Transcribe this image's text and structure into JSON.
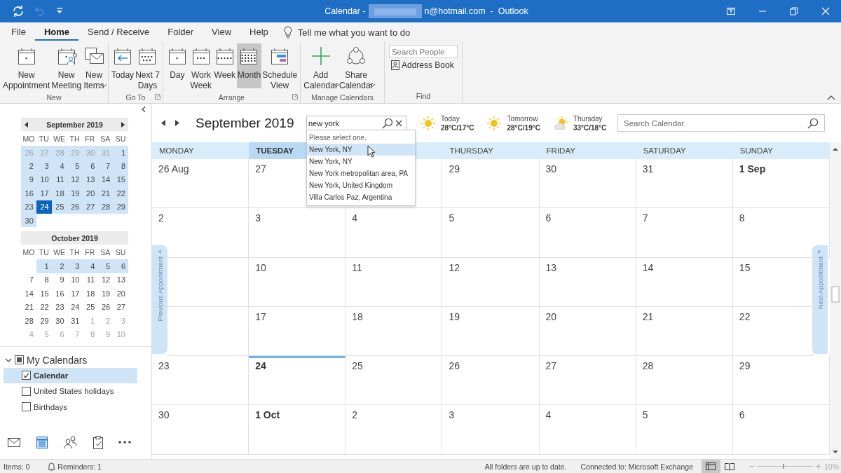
{
  "title_bar": {
    "title_start": "Calendar -",
    "title_end": "n@hotmail.com  -  Outlook"
  },
  "ribbon": {
    "tabs": [
      {
        "label": "File",
        "selected": false
      },
      {
        "label": "Home",
        "selected": true
      },
      {
        "label": "Send / Receive",
        "selected": false
      },
      {
        "label": "Folder",
        "selected": false
      },
      {
        "label": "View",
        "selected": false
      },
      {
        "label": "Help",
        "selected": false
      }
    ],
    "tell_me": "Tell me what you want to do",
    "groups": [
      {
        "kind": "buttons",
        "label": "New",
        "launcher": false,
        "buttons": [
          {
            "kind": "appointment",
            "label": "New\nAppointment",
            "dropdown": false,
            "selected": false
          },
          {
            "kind": "meeting",
            "label": "New\nMeeting",
            "dropdown": false,
            "selected": false
          },
          {
            "kind": "items",
            "label": "New\nItems",
            "dropdown": true,
            "selected": false
          }
        ]
      },
      {
        "kind": "buttons",
        "label": "Go To",
        "launcher": true,
        "buttons": [
          {
            "kind": "today",
            "label": "Today",
            "dropdown": false,
            "selected": false
          },
          {
            "kind": "next7",
            "label": "Next 7\nDays",
            "dropdown": false,
            "selected": false
          }
        ]
      },
      {
        "kind": "buttons",
        "label": "Arrange",
        "launcher": true,
        "buttons": [
          {
            "kind": "day",
            "label": "Day",
            "dropdown": false,
            "selected": false
          },
          {
            "kind": "workweek",
            "label": "Work\nWeek",
            "dropdown": false,
            "selected": false
          },
          {
            "kind": "week",
            "label": "Week",
            "dropdown": false,
            "selected": false
          },
          {
            "kind": "month",
            "label": "Month",
            "dropdown": false,
            "selected": true
          },
          {
            "kind": "schedule",
            "label": "Schedule\nView",
            "dropdown": false,
            "selected": false
          }
        ]
      },
      {
        "kind": "buttons",
        "label": "Manage Calendars",
        "launcher": false,
        "buttons": [
          {
            "kind": "add",
            "label": "Add\nCalendar",
            "dropdown": true,
            "selected": false
          },
          {
            "kind": "share",
            "label": "Share\nCalendar",
            "dropdown": true,
            "selected": false
          }
        ]
      },
      {
        "kind": "find",
        "label": "Find",
        "launcher": false,
        "search_placeholder": "Search People",
        "address_book": "Address Book"
      }
    ]
  },
  "sidebar": {
    "mini_calendars": [
      {
        "title": "September 2019",
        "weekdays": [
          "MO",
          "TU",
          "WE",
          "TH",
          "FR",
          "SA",
          "SU"
        ],
        "weeks": [
          [
            {
              "day": "26",
              "in_view": true,
              "selected": false,
              "outside": true
            },
            {
              "day": "27",
              "in_view": true,
              "selected": false,
              "outside": true
            },
            {
              "day": "28",
              "in_view": true,
              "selected": false,
              "outside": true
            },
            {
              "day": "29",
              "in_view": true,
              "selected": false,
              "outside": true
            },
            {
              "day": "30",
              "in_view": true,
              "selected": false,
              "outside": true
            },
            {
              "day": "31",
              "in_view": true,
              "selected": false,
              "outside": true
            },
            {
              "day": "1",
              "in_view": true,
              "selected": false,
              "outside": false
            }
          ],
          [
            {
              "day": "2",
              "in_view": true,
              "selected": false,
              "outside": false
            },
            {
              "day": "3",
              "in_view": true,
              "selected": false,
              "outside": false
            },
            {
              "day": "4",
              "in_view": true,
              "selected": false,
              "outside": false
            },
            {
              "day": "5",
              "in_view": true,
              "selected": false,
              "outside": false
            },
            {
              "day": "6",
              "in_view": true,
              "selected": false,
              "outside": false
            },
            {
              "day": "7",
              "in_view": true,
              "selected": false,
              "outside": false
            },
            {
              "day": "8",
              "in_view": true,
              "selected": false,
              "outside": false
            }
          ],
          [
            {
              "day": "9",
              "in_view": true,
              "selected": false,
              "outside": false
            },
            {
              "day": "10",
              "in_view": true,
              "selected": false,
              "outside": false
            },
            {
              "day": "11",
              "in_view": true,
              "selected": false,
              "outside": false
            },
            {
              "day": "12",
              "in_view": true,
              "selected": false,
              "outside": false
            },
            {
              "day": "13",
              "in_view": true,
              "selected": false,
              "outside": false
            },
            {
              "day": "14",
              "in_view": true,
              "selected": false,
              "outside": false
            },
            {
              "day": "15",
              "in_view": true,
              "selected": false,
              "outside": false
            }
          ],
          [
            {
              "day": "16",
              "in_view": true,
              "selected": false,
              "outside": false
            },
            {
              "day": "17",
              "in_view": true,
              "selected": false,
              "outside": false
            },
            {
              "day": "18",
              "in_view": true,
              "selected": false,
              "outside": false
            },
            {
              "day": "19",
              "in_view": true,
              "selected": false,
              "outside": false
            },
            {
              "day": "20",
              "in_view": true,
              "selected": false,
              "outside": false
            },
            {
              "day": "21",
              "in_view": true,
              "selected": false,
              "outside": false
            },
            {
              "day": "22",
              "in_view": true,
              "selected": false,
              "outside": false
            }
          ],
          [
            {
              "day": "23",
              "in_view": true,
              "selected": false,
              "outside": false
            },
            {
              "day": "24",
              "in_view": true,
              "selected": true,
              "outside": false
            },
            {
              "day": "25",
              "in_view": true,
              "selected": false,
              "outside": false
            },
            {
              "day": "26",
              "in_view": true,
              "selected": false,
              "outside": false
            },
            {
              "day": "27",
              "in_view": true,
              "selected": false,
              "outside": false
            },
            {
              "day": "28",
              "in_view": true,
              "selected": false,
              "outside": false
            },
            {
              "day": "29",
              "in_view": true,
              "selected": false,
              "outside": false
            }
          ],
          [
            {
              "day": "30",
              "in_view": true,
              "selected": false,
              "outside": false
            }
          ]
        ]
      },
      {
        "title": "October 2019",
        "weekdays": [
          "MO",
          "TU",
          "WE",
          "TH",
          "FR",
          "SA",
          "SU"
        ],
        "weeks": [
          [
            {
              "day": "1",
              "in_view": true,
              "selected": false,
              "outside": false
            },
            {
              "day": "2",
              "in_view": true,
              "selected": false,
              "outside": false
            },
            {
              "day": "3",
              "in_view": true,
              "selected": false,
              "outside": false
            },
            {
              "day": "4",
              "in_view": true,
              "selected": false,
              "outside": false
            },
            {
              "day": "5",
              "in_view": true,
              "selected": false,
              "outside": false
            },
            {
              "day": "6",
              "in_view": true,
              "selected": false,
              "outside": false
            }
          ],
          [
            {
              "day": "7",
              "in_view": false,
              "selected": false,
              "outside": false
            },
            {
              "day": "8",
              "in_view": false,
              "selected": false,
              "outside": false
            },
            {
              "day": "9",
              "in_view": false,
              "selected": false,
              "outside": false
            },
            {
              "day": "10",
              "in_view": false,
              "selected": false,
              "outside": false
            },
            {
              "day": "11",
              "in_view": false,
              "selected": false,
              "outside": false
            },
            {
              "day": "12",
              "in_view": false,
              "selected": false,
              "outside": false
            },
            {
              "day": "13",
              "in_view": false,
              "selected": false,
              "outside": false
            }
          ],
          [
            {
              "day": "14",
              "in_view": false,
              "selected": false,
              "outside": false
            },
            {
              "day": "15",
              "in_view": false,
              "selected": false,
              "outside": false
            },
            {
              "day": "16",
              "in_view": false,
              "selected": false,
              "outside": false
            },
            {
              "day": "17",
              "in_view": false,
              "selected": false,
              "outside": false
            },
            {
              "day": "18",
              "in_view": false,
              "selected": false,
              "outside": false
            },
            {
              "day": "19",
              "in_view": false,
              "selected": false,
              "outside": false
            },
            {
              "day": "20",
              "in_view": false,
              "selected": false,
              "outside": false
            }
          ],
          [
            {
              "day": "21",
              "in_view": false,
              "selected": false,
              "outside": false
            },
            {
              "day": "22",
              "in_view": false,
              "selected": false,
              "outside": false
            },
            {
              "day": "23",
              "in_view": false,
              "selected": false,
              "outside": false
            },
            {
              "day": "24",
              "in_view": false,
              "selected": false,
              "outside": false
            },
            {
              "day": "25",
              "in_view": false,
              "selected": false,
              "outside": false
            },
            {
              "day": "26",
              "in_view": false,
              "selected": false,
              "outside": false
            },
            {
              "day": "27",
              "in_view": false,
              "selected": false,
              "outside": false
            }
          ],
          [
            {
              "day": "28",
              "in_view": false,
              "selected": false,
              "outside": false
            },
            {
              "day": "29",
              "in_view": false,
              "selected": false,
              "outside": false
            },
            {
              "day": "30",
              "in_view": false,
              "selected": false,
              "outside": false
            },
            {
              "day": "31",
              "in_view": false,
              "selected": false,
              "outside": false
            },
            {
              "day": "1",
              "in_view": false,
              "selected": false,
              "outside": true
            },
            {
              "day": "2",
              "in_view": false,
              "selected": false,
              "outside": true
            },
            {
              "day": "3",
              "in_view": false,
              "selected": false,
              "outside": true
            }
          ],
          [
            {
              "day": "4",
              "in_view": false,
              "selected": false,
              "outside": true
            },
            {
              "day": "5",
              "in_view": false,
              "selected": false,
              "outside": true
            },
            {
              "day": "6",
              "in_view": false,
              "selected": false,
              "outside": true
            },
            {
              "day": "7",
              "in_view": false,
              "selected": false,
              "outside": true
            },
            {
              "day": "8",
              "in_view": false,
              "selected": false,
              "outside": true
            },
            {
              "day": "9",
              "in_view": false,
              "selected": false,
              "outside": true
            },
            {
              "day": "10",
              "in_view": false,
              "selected": false,
              "outside": true
            }
          ]
        ]
      }
    ],
    "calendar_groups": [
      {
        "label": "My Calendars",
        "expanded": true,
        "indeterminate": true,
        "items": [
          {
            "label": "Calendar",
            "checked": true,
            "selected": true
          },
          {
            "label": "United States holidays",
            "checked": false,
            "selected": false
          },
          {
            "label": "Birthdays",
            "checked": false,
            "selected": false
          }
        ]
      }
    ],
    "nav_bar": [
      {
        "kind": "mail",
        "selected": false
      },
      {
        "kind": "calendar",
        "selected": true
      },
      {
        "kind": "people",
        "selected": false
      },
      {
        "kind": "tasks",
        "selected": false
      },
      {
        "kind": "more",
        "selected": false
      }
    ]
  },
  "calendar": {
    "month_title": "September 2019",
    "location_search": {
      "value": "new york"
    },
    "location_dropdown": {
      "prompt": "Please select one.",
      "options": [
        {
          "label": "New York, NY",
          "selected": true
        },
        {
          "label": "New York, NY",
          "selected": false
        },
        {
          "label": "New York metropolitan area, PA",
          "selected": false
        },
        {
          "label": "New York, United Kingdom",
          "selected": false
        },
        {
          "label": "Villa Carlos Paz, Argentina",
          "selected": false
        }
      ]
    },
    "weather": [
      {
        "kind": "sunny",
        "day": "Today",
        "temps": "28°C/17°C"
      },
      {
        "kind": "sunny",
        "day": "Tomorrow",
        "temps": "28°C/19°C"
      },
      {
        "kind": "partly-cloudy",
        "day": "Thursday",
        "temps": "33°C/18°C"
      }
    ],
    "search_calendar": {
      "placeholder": "Search Calendar"
    },
    "day_headers": [
      {
        "label": "MONDAY",
        "selected": false
      },
      {
        "label": "TUESDAY",
        "selected": true
      },
      {
        "label": "THURSDAY",
        "selected": false
      },
      {
        "label": "FRIDAY",
        "selected": false
      },
      {
        "label": "SATURDAY",
        "selected": false
      },
      {
        "label": "SUNDAY",
        "selected": false
      }
    ],
    "weeks": [
      [
        {
          "date": "26 Aug",
          "bold": false,
          "today": false
        },
        {
          "date": "27",
          "bold": false,
          "today": false
        },
        {
          "today": false
        },
        {
          "date": "29",
          "bold": false,
          "today": false
        },
        {
          "date": "30",
          "bold": false,
          "today": false
        },
        {
          "date": "31",
          "bold": false,
          "today": false
        },
        {
          "date": "1 Sep",
          "bold": true,
          "today": false
        }
      ],
      [
        {
          "date": "2",
          "bold": false,
          "today": false
        },
        {
          "date": "3",
          "bold": false,
          "today": false
        },
        {
          "date": "4",
          "bold": false,
          "today": false
        },
        {
          "date": "5",
          "bold": false,
          "today": false
        },
        {
          "date": "6",
          "bold": false,
          "today": false
        },
        {
          "date": "7",
          "bold": false,
          "today": false
        },
        {
          "date": "8",
          "bold": false,
          "today": false
        }
      ],
      [
        {
          "today": false
        },
        {
          "date": "10",
          "bold": false,
          "today": false
        },
        {
          "date": "11",
          "bold": false,
          "today": false
        },
        {
          "date": "12",
          "bold": false,
          "today": false
        },
        {
          "date": "13",
          "bold": false,
          "today": false
        },
        {
          "date": "14",
          "bold": false,
          "today": false
        },
        {
          "date": "15",
          "bold": false,
          "today": false
        }
      ],
      [
        {
          "today": false
        },
        {
          "date": "17",
          "bold": false,
          "today": false
        },
        {
          "date": "18",
          "bold": false,
          "today": false
        },
        {
          "date": "19",
          "bold": false,
          "today": false
        },
        {
          "date": "20",
          "bold": false,
          "today": false
        },
        {
          "date": "21",
          "bold": false,
          "today": false
        },
        {
          "date": "22",
          "bold": false,
          "today": false
        }
      ],
      [
        {
          "date": "23",
          "bold": false,
          "today": false
        },
        {
          "date": "24",
          "bold": true,
          "today": true
        },
        {
          "date": "25",
          "bold": false,
          "today": false
        },
        {
          "date": "26",
          "bold": false,
          "today": false
        },
        {
          "date": "27",
          "bold": false,
          "today": false
        },
        {
          "date": "28",
          "bold": false,
          "today": false
        },
        {
          "date": "29",
          "bold": false,
          "today": false
        }
      ],
      [
        {
          "date": "30",
          "bold": false,
          "today": false
        },
        {
          "date": "1 Oct",
          "bold": true,
          "today": false
        },
        {
          "date": "2",
          "bold": false,
          "today": false
        },
        {
          "date": "3",
          "bold": false,
          "today": false
        },
        {
          "date": "4",
          "bold": false,
          "today": false
        },
        {
          "date": "5",
          "bold": false,
          "today": false
        },
        {
          "date": "6",
          "bold": false,
          "today": false
        }
      ]
    ],
    "previous_tab": "Previous Appointment",
    "next_tab": "Next Appointment"
  },
  "status_bar": {
    "items": "Items: 0",
    "reminders": "Reminders: 1",
    "sync": "All folders are up to date.",
    "connection": "Connected to: Microsoft Exchange",
    "views": [
      {
        "kind": "normal",
        "selected": true
      },
      {
        "kind": "reading",
        "selected": false
      }
    ],
    "zoom": {
      "level": 0.47,
      "reading": "10%"
    }
  }
}
